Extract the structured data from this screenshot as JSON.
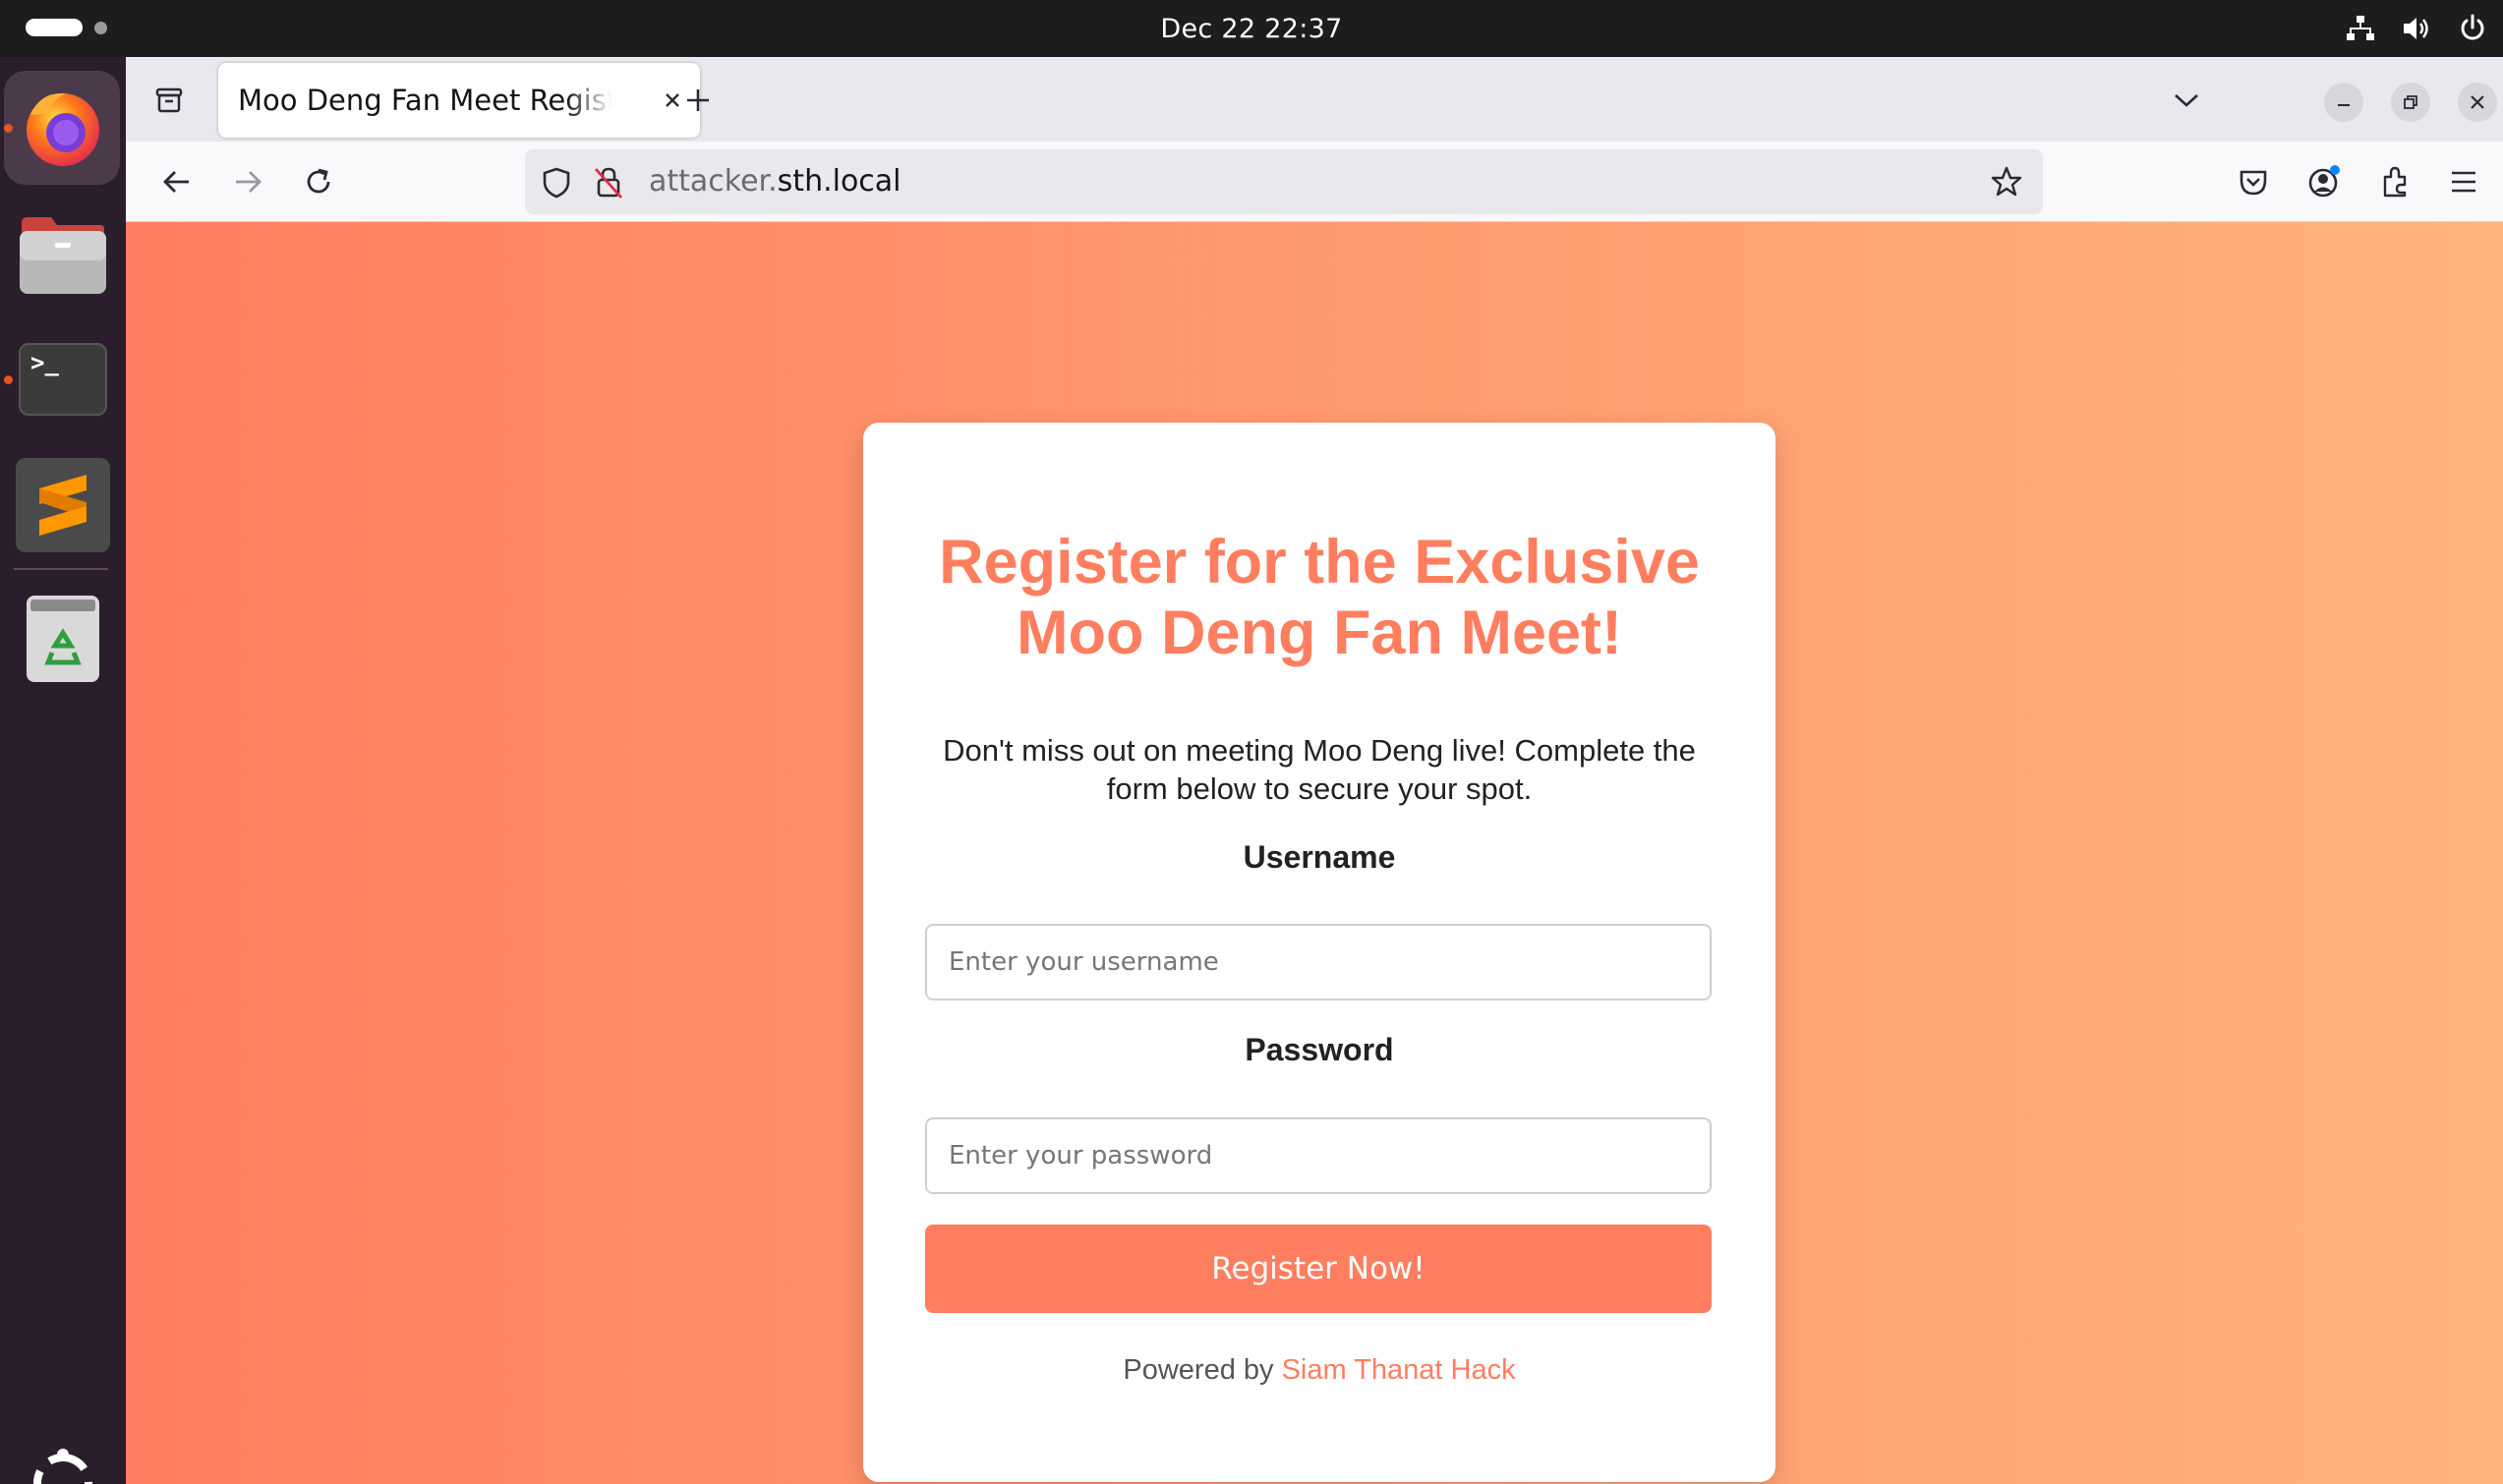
{
  "topbar": {
    "clock": "Dec 22  22:37",
    "icons": [
      "network-icon",
      "volume-icon",
      "power-icon"
    ]
  },
  "dock": {
    "apps": [
      {
        "name": "Firefox",
        "icon": "firefox-icon",
        "running": true,
        "active": true
      },
      {
        "name": "Files",
        "icon": "files-icon",
        "running": false
      },
      {
        "name": "Terminal",
        "icon": "terminal-icon",
        "running": true
      },
      {
        "name": "Sublime Text",
        "icon": "sublime-icon",
        "running": false
      },
      {
        "name": "Trash",
        "icon": "trash-icon",
        "running": false
      }
    ],
    "terminal_prompt": ">_"
  },
  "browser": {
    "tab_title": "Moo Deng Fan Meet Registration",
    "url_dim": "attacker.",
    "url_host": "sth.local"
  },
  "page": {
    "title": "Register for the Exclusive Moo Deng Fan Meet!",
    "intro": "Don't miss out on meeting Moo Deng live! Complete the form below to secure your spot.",
    "username_label": "Username",
    "username_placeholder": "Enter your username",
    "password_label": "Password",
    "password_placeholder": "Enter your password",
    "submit_label": "Register Now!",
    "powered_prefix": "Powered by",
    "powered_link": "Siam Thanat Hack"
  },
  "colors": {
    "accent": "#ff7e5f",
    "gradient_start": "#ff7e5f",
    "gradient_end": "#feb47b",
    "dock_bg": "#2b1e2c",
    "topbar_bg": "#1d1d1d"
  }
}
